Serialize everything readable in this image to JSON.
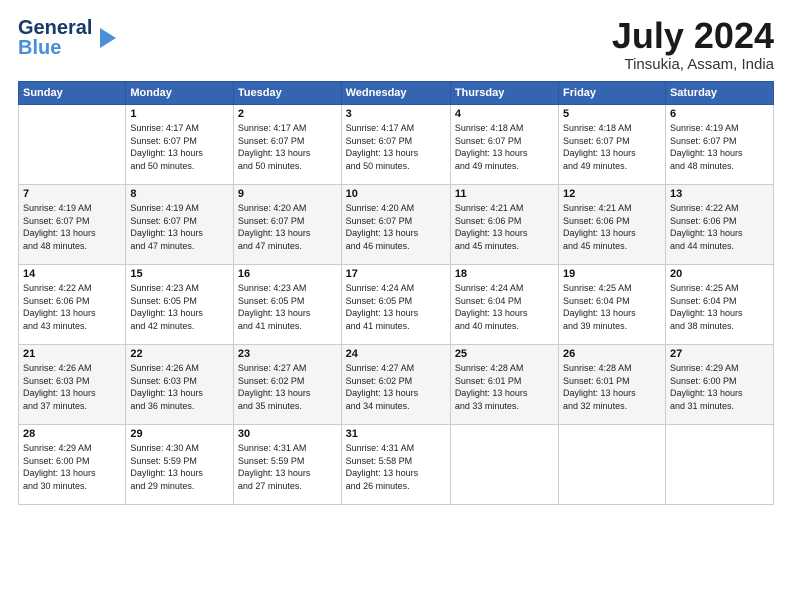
{
  "logo": {
    "text1": "General",
    "text2": "Blue"
  },
  "title": {
    "month_year": "July 2024",
    "location": "Tinsukia, Assam, India"
  },
  "days_of_week": [
    "Sunday",
    "Monday",
    "Tuesday",
    "Wednesday",
    "Thursday",
    "Friday",
    "Saturday"
  ],
  "weeks": [
    [
      {
        "day": "",
        "info": ""
      },
      {
        "day": "1",
        "info": "Sunrise: 4:17 AM\nSunset: 6:07 PM\nDaylight: 13 hours\nand 50 minutes."
      },
      {
        "day": "2",
        "info": "Sunrise: 4:17 AM\nSunset: 6:07 PM\nDaylight: 13 hours\nand 50 minutes."
      },
      {
        "day": "3",
        "info": "Sunrise: 4:17 AM\nSunset: 6:07 PM\nDaylight: 13 hours\nand 50 minutes."
      },
      {
        "day": "4",
        "info": "Sunrise: 4:18 AM\nSunset: 6:07 PM\nDaylight: 13 hours\nand 49 minutes."
      },
      {
        "day": "5",
        "info": "Sunrise: 4:18 AM\nSunset: 6:07 PM\nDaylight: 13 hours\nand 49 minutes."
      },
      {
        "day": "6",
        "info": "Sunrise: 4:19 AM\nSunset: 6:07 PM\nDaylight: 13 hours\nand 48 minutes."
      }
    ],
    [
      {
        "day": "7",
        "info": "Sunrise: 4:19 AM\nSunset: 6:07 PM\nDaylight: 13 hours\nand 48 minutes."
      },
      {
        "day": "8",
        "info": "Sunrise: 4:19 AM\nSunset: 6:07 PM\nDaylight: 13 hours\nand 47 minutes."
      },
      {
        "day": "9",
        "info": "Sunrise: 4:20 AM\nSunset: 6:07 PM\nDaylight: 13 hours\nand 47 minutes."
      },
      {
        "day": "10",
        "info": "Sunrise: 4:20 AM\nSunset: 6:07 PM\nDaylight: 13 hours\nand 46 minutes."
      },
      {
        "day": "11",
        "info": "Sunrise: 4:21 AM\nSunset: 6:06 PM\nDaylight: 13 hours\nand 45 minutes."
      },
      {
        "day": "12",
        "info": "Sunrise: 4:21 AM\nSunset: 6:06 PM\nDaylight: 13 hours\nand 45 minutes."
      },
      {
        "day": "13",
        "info": "Sunrise: 4:22 AM\nSunset: 6:06 PM\nDaylight: 13 hours\nand 44 minutes."
      }
    ],
    [
      {
        "day": "14",
        "info": "Sunrise: 4:22 AM\nSunset: 6:06 PM\nDaylight: 13 hours\nand 43 minutes."
      },
      {
        "day": "15",
        "info": "Sunrise: 4:23 AM\nSunset: 6:05 PM\nDaylight: 13 hours\nand 42 minutes."
      },
      {
        "day": "16",
        "info": "Sunrise: 4:23 AM\nSunset: 6:05 PM\nDaylight: 13 hours\nand 41 minutes."
      },
      {
        "day": "17",
        "info": "Sunrise: 4:24 AM\nSunset: 6:05 PM\nDaylight: 13 hours\nand 41 minutes."
      },
      {
        "day": "18",
        "info": "Sunrise: 4:24 AM\nSunset: 6:04 PM\nDaylight: 13 hours\nand 40 minutes."
      },
      {
        "day": "19",
        "info": "Sunrise: 4:25 AM\nSunset: 6:04 PM\nDaylight: 13 hours\nand 39 minutes."
      },
      {
        "day": "20",
        "info": "Sunrise: 4:25 AM\nSunset: 6:04 PM\nDaylight: 13 hours\nand 38 minutes."
      }
    ],
    [
      {
        "day": "21",
        "info": "Sunrise: 4:26 AM\nSunset: 6:03 PM\nDaylight: 13 hours\nand 37 minutes."
      },
      {
        "day": "22",
        "info": "Sunrise: 4:26 AM\nSunset: 6:03 PM\nDaylight: 13 hours\nand 36 minutes."
      },
      {
        "day": "23",
        "info": "Sunrise: 4:27 AM\nSunset: 6:02 PM\nDaylight: 13 hours\nand 35 minutes."
      },
      {
        "day": "24",
        "info": "Sunrise: 4:27 AM\nSunset: 6:02 PM\nDaylight: 13 hours\nand 34 minutes."
      },
      {
        "day": "25",
        "info": "Sunrise: 4:28 AM\nSunset: 6:01 PM\nDaylight: 13 hours\nand 33 minutes."
      },
      {
        "day": "26",
        "info": "Sunrise: 4:28 AM\nSunset: 6:01 PM\nDaylight: 13 hours\nand 32 minutes."
      },
      {
        "day": "27",
        "info": "Sunrise: 4:29 AM\nSunset: 6:00 PM\nDaylight: 13 hours\nand 31 minutes."
      }
    ],
    [
      {
        "day": "28",
        "info": "Sunrise: 4:29 AM\nSunset: 6:00 PM\nDaylight: 13 hours\nand 30 minutes."
      },
      {
        "day": "29",
        "info": "Sunrise: 4:30 AM\nSunset: 5:59 PM\nDaylight: 13 hours\nand 29 minutes."
      },
      {
        "day": "30",
        "info": "Sunrise: 4:31 AM\nSunset: 5:59 PM\nDaylight: 13 hours\nand 27 minutes."
      },
      {
        "day": "31",
        "info": "Sunrise: 4:31 AM\nSunset: 5:58 PM\nDaylight: 13 hours\nand 26 minutes."
      },
      {
        "day": "",
        "info": ""
      },
      {
        "day": "",
        "info": ""
      },
      {
        "day": "",
        "info": ""
      }
    ]
  ]
}
